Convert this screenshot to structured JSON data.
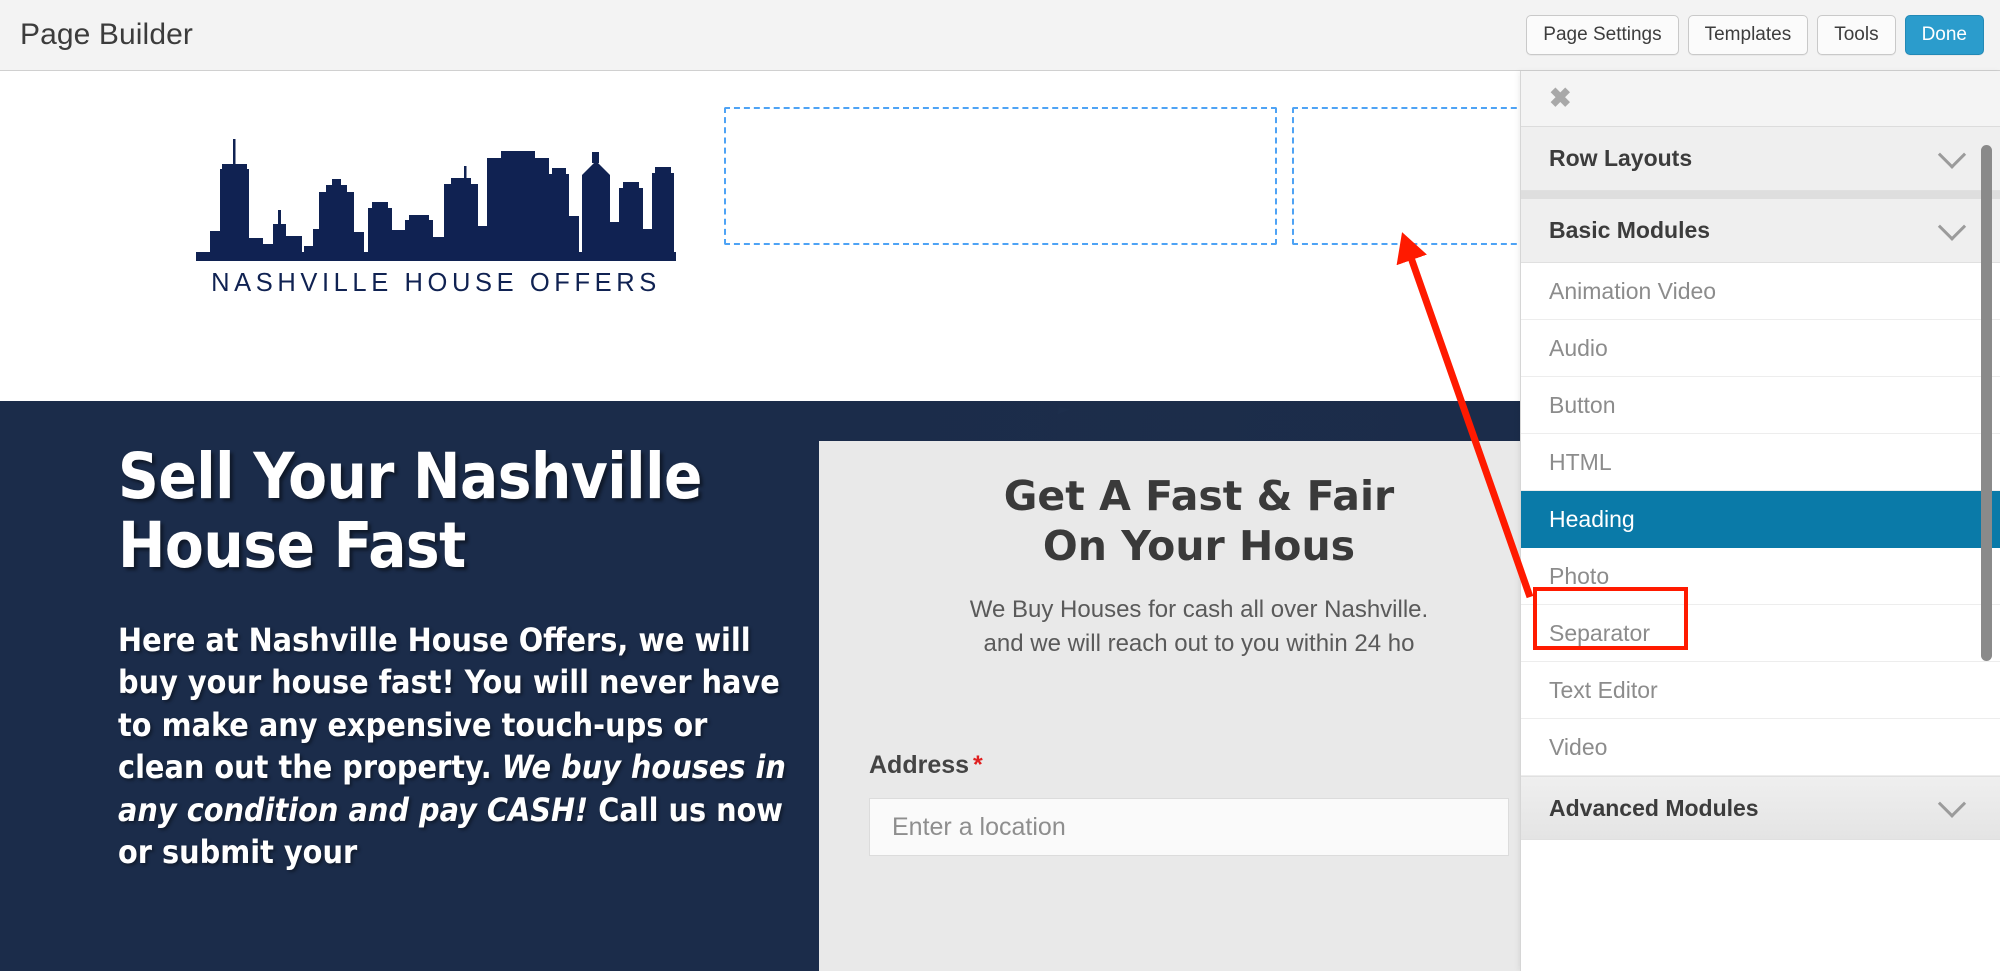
{
  "adminbar": {
    "brand": "Page Builder",
    "buttons": [
      {
        "label": "Page Settings",
        "primary": false
      },
      {
        "label": "Templates",
        "primary": false
      },
      {
        "label": "Tools",
        "primary": false
      },
      {
        "label": "Done",
        "primary": true
      }
    ],
    "accent_color": "#2b9ccc"
  },
  "site": {
    "logo": {
      "icon": "nashville-skyline-icon",
      "wordmark": "NASHVILLE HOUSE OFFERS",
      "color": "#102252"
    },
    "empty_columns": [
      {
        "name": "empty-column-placeholder-1"
      },
      {
        "name": "empty-column-placeholder-2"
      }
    ],
    "placeholder_border_color": "#4ea3f5"
  },
  "hero": {
    "background_color": "#1b2c4a",
    "title": "Sell Your Nashville House Fast",
    "body_part1": "Here at Nashville House Offers, we will buy your house fast! You will never have to make any expensive touch-ups or clean out the property. ",
    "body_emphasis": "We buy houses in any condition and pay CASH!",
    "body_part2": " Call us now or submit your"
  },
  "form_card": {
    "title_line1": "Get A Fast & Fair",
    "title_line2": "On Your Hous",
    "subtitle_line1": "We Buy Houses for cash all over Nashville. ",
    "subtitle_line2": "and we will reach out to you within 24 ho",
    "address_label": "Address",
    "required_marker": "*",
    "address_placeholder": "Enter a location",
    "address_value": ""
  },
  "panel": {
    "close_icon": "close-icon",
    "sections": [
      {
        "label": "Row Layouts",
        "icon": "chevron-down-icon"
      },
      {
        "label": "Basic Modules",
        "icon": "chevron-down-icon"
      }
    ],
    "modules": [
      {
        "label": "Animation Video",
        "selected": false
      },
      {
        "label": "Audio",
        "selected": false
      },
      {
        "label": "Button",
        "selected": false
      },
      {
        "label": "HTML",
        "selected": false
      },
      {
        "label": "Heading",
        "selected": true
      },
      {
        "label": "Photo",
        "selected": false
      },
      {
        "label": "Separator",
        "selected": false
      },
      {
        "label": "Text Editor",
        "selected": false
      },
      {
        "label": "Video",
        "selected": false
      }
    ],
    "bottom_section": {
      "label": "Advanced Modules",
      "icon": "chevron-down-icon"
    },
    "selected_color": "#0a7aa8"
  },
  "annotation": {
    "arrow_color": "#ff1a00",
    "highlight_color": "#ff1a00",
    "highlight_target": "Heading"
  }
}
